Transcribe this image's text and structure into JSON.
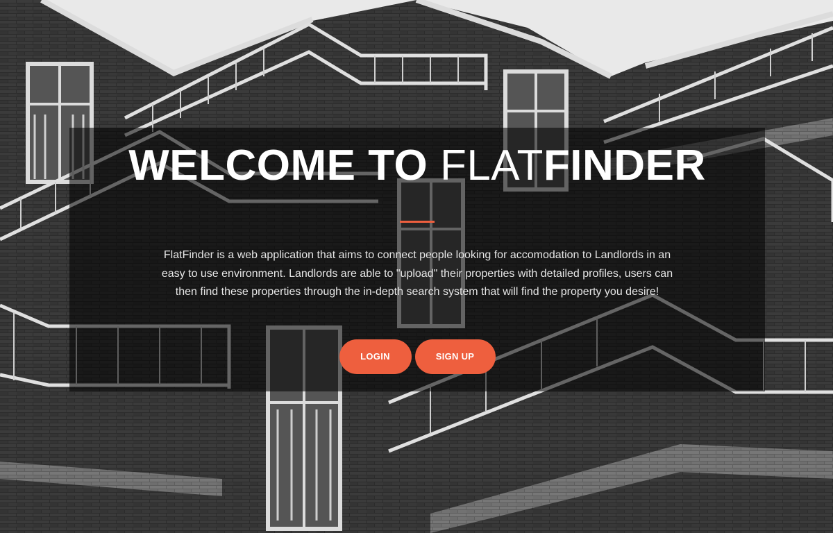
{
  "hero": {
    "title_prefix": "WELCOME TO ",
    "title_light": "FLAT",
    "title_bold": "FINDER",
    "description": "FlatFinder is a web application that aims to connect people looking for accomodation to Landlords in an easy to use environment. Landlords are able to \"upload\" their properties with detailed profiles, users can then find these properties through the in-depth search system that will find the property you desire!",
    "login_label": "LOGIN",
    "signup_label": "SIGN UP"
  },
  "colors": {
    "accent": "#ee5f3e",
    "text": "#ffffff"
  }
}
